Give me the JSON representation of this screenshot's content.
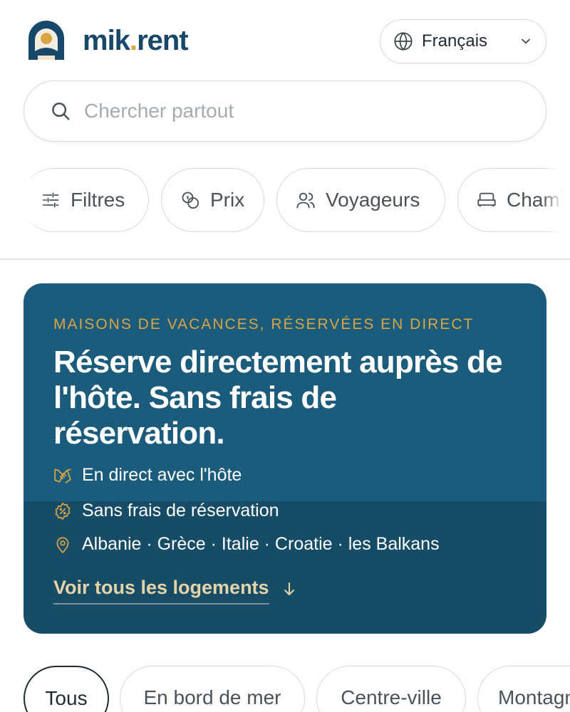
{
  "brand": {
    "name_main": "mik",
    "name_dot": ".",
    "name_suffix": "rent",
    "colors": {
      "primary": "#17486a",
      "accent": "#d9a545"
    }
  },
  "language": {
    "selected": "Français",
    "icon": "globe-icon"
  },
  "search": {
    "placeholder": "Chercher partout",
    "value": ""
  },
  "filters": [
    {
      "label": "Filtres",
      "icon": "sliders-icon"
    },
    {
      "label": "Prix",
      "icon": "coins-icon"
    },
    {
      "label": "Voyageurs",
      "icon": "users-icon"
    },
    {
      "label": "Chambres",
      "icon": "bed-icon"
    }
  ],
  "hero": {
    "eyebrow": "MAISONS DE VACANCES, RÉSERVÉES EN DIRECT",
    "headline": "Réserve directement auprès de l'hôte. Sans frais de réservation.",
    "features": [
      {
        "text": "En direct avec l'hôte",
        "icon": "handshake-icon"
      },
      {
        "text": "Sans frais de réservation",
        "icon": "discount-badge-icon"
      },
      {
        "text": "Albanie · Grèce · Italie · Croatie · les Balkans",
        "icon": "map-pin-icon"
      }
    ],
    "cta": "Voir tous les logements",
    "colors": {
      "background": "#1b5b7c",
      "eyebrow": "#d9a545",
      "cta": "#e7d3a8"
    }
  },
  "categories": [
    {
      "label": "Tous",
      "active": true
    },
    {
      "label": "En bord de mer",
      "active": false
    },
    {
      "label": "Centre-ville",
      "active": false
    },
    {
      "label": "Montagne",
      "active": false
    }
  ]
}
